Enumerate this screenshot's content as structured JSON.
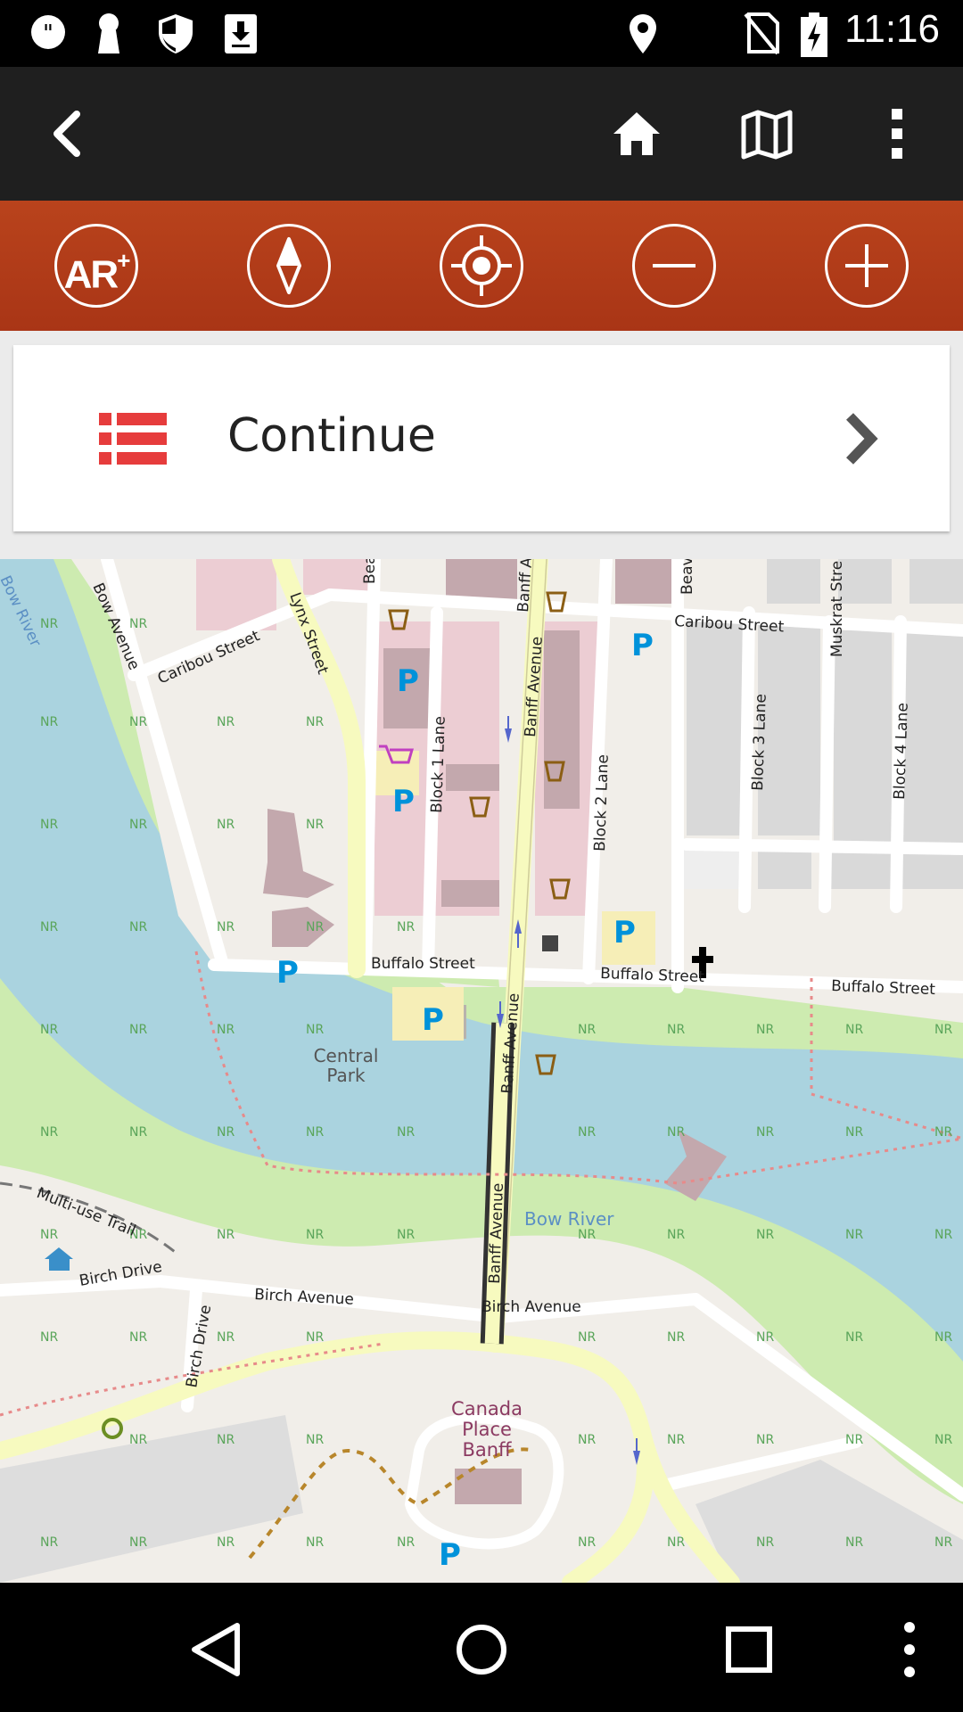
{
  "status_bar": {
    "time": "11:16",
    "left_icons": [
      "quote-icon",
      "keyhole-icon",
      "shield-icon",
      "download-icon"
    ],
    "right_icons": [
      "location-icon",
      "no-sim-icon",
      "battery-charging-icon"
    ]
  },
  "action_bar": {
    "icons": [
      "back-icon",
      "home-icon",
      "map-icon",
      "overflow-menu-icon"
    ]
  },
  "toolbar": {
    "ar_label": "AR",
    "ar_plus": "+",
    "buttons": [
      "ar-plus",
      "compass",
      "locate",
      "zoom-out",
      "zoom-in"
    ],
    "color": "#b03c19"
  },
  "card": {
    "label": "Continue",
    "icon": "list-icon",
    "icon_color": "#e63c3c"
  },
  "map": {
    "labels": {
      "bow_river_top": "Bow River",
      "bow_avenue": "Bow Avenue",
      "caribou_street_left": "Caribou Street",
      "caribou_street_right": "Caribou Street",
      "lynx_street": "Lynx Street",
      "bear_street": "Bea",
      "banff_avenue_top": "Banff A",
      "banff_avenue_1": "Banff Avenue",
      "beaver_street": "Beav",
      "muskrat_street": "Muskrat Stre",
      "block1_lane": "Block 1 Lane",
      "block2_lane": "Block 2 Lane",
      "block3_lane": "Block 3 Lane",
      "block4_lane": "Block 4 Lane",
      "buffalo_street_1": "Buffalo Street",
      "buffalo_street_2": "Buffalo Street",
      "buffalo_street_3": "Buffalo Street",
      "banff_avenue_2": "Banff Avenue",
      "central_park_1": "Central",
      "central_park_2": "Park",
      "multi_use_trail": "Multi-use Trail",
      "bow_river_main": "Bow River",
      "banff_avenue_3": "Banff Avenue",
      "birch_drive_1": "Birch Drive",
      "birch_drive_2": "Birch Drive",
      "birch_avenue_1": "Birch Avenue",
      "birch_avenue_2": "Birch Avenue",
      "canada_place_1": "Canada",
      "canada_place_2": "Place",
      "canada_place_3": "Banff",
      "nr": "NR",
      "parking": "P"
    }
  },
  "nav_bar": {
    "icons": [
      "back-triangle-icon",
      "home-circle-icon",
      "recents-square-icon",
      "more-vert-icon"
    ]
  }
}
